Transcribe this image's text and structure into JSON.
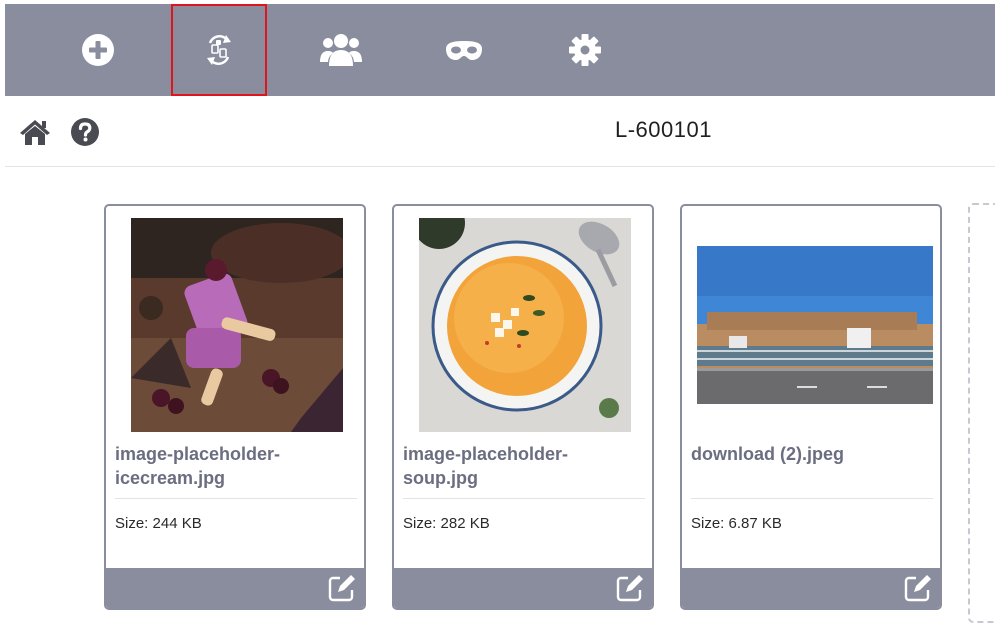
{
  "toolbar": {
    "items": [
      {
        "icon": "plus-circle-icon",
        "active": false
      },
      {
        "icon": "sync-icon",
        "active": true
      },
      {
        "icon": "users-icon",
        "active": false
      },
      {
        "icon": "mask-icon",
        "active": false
      },
      {
        "icon": "gear-icon",
        "active": false
      }
    ]
  },
  "subheader": {
    "home_icon": "home-icon",
    "help_icon": "help-circle-icon",
    "title": "L-600101"
  },
  "files": [
    {
      "name": "image-placeholder-\nicecream.jpg",
      "size": "Size: 244 KB",
      "thumb": "icecream"
    },
    {
      "name": "image-placeholder-\nsoup.jpg",
      "size": "Size: 282 KB",
      "thumb": "soup"
    },
    {
      "name": "download (2).jpeg",
      "size": "Size: 6.87 KB",
      "thumb": "building"
    }
  ],
  "colors": {
    "toolbar_bg": "#8a8d9d",
    "active_border": "#e0141c",
    "title_text": "#6b6e80",
    "icon_dark": "#4a4a52"
  }
}
